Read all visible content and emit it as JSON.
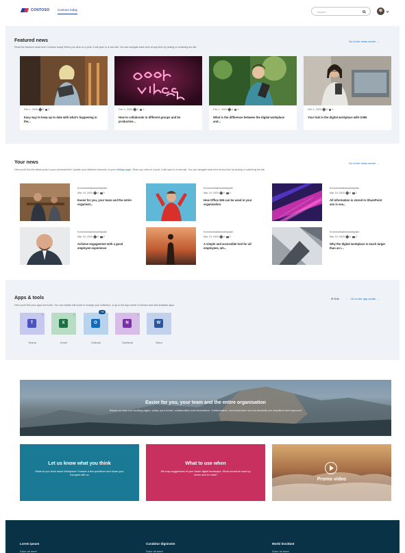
{
  "header": {
    "brand": "CONTOSO",
    "nav_tab": "Contoso today",
    "search_placeholder": "Search"
  },
  "featured": {
    "title": "Featured news",
    "description": "Read the featured news from Contoso today! When you click on a post, it will open in a new tab. You can navigate back here at any time by closing or switching the tab.",
    "link": "Go to the news center →",
    "cards": [
      {
        "date": "Feb 1, 2020",
        "likes": "0",
        "comments": "0",
        "title": "Easy way to keep up to date with what's happening in the..."
      },
      {
        "date": "Feb 1, 2020",
        "likes": "0",
        "comments": "0",
        "title": "How to collaborate in different groups and be productive..."
      },
      {
        "date": "Feb 1, 2020",
        "likes": "0",
        "comments": "0",
        "title": "What is the difference between the digital workplace and..."
      },
      {
        "date": "Feb 1, 2020",
        "likes": "0",
        "comments": "0",
        "title": "Your hub in the digital workplace with O365"
      }
    ]
  },
  "your_news": {
    "title": "Your news",
    "description_pre": "Here you'll find the latest posts in your personal feed. Update your selected channels on your ",
    "description_link": "settings page",
    "description_post": ". When you click on a post, it will open in a new tab. You can navigate back here at any time by closing or switching the tab.",
    "link": "Go to the news center →",
    "cards": [
      {
        "category": "Kommunikationswebplatz",
        "date": "Mar 19, 2020",
        "likes": "0",
        "comments": "0",
        "title": "Easier for you, your team and the entire organisat..."
      },
      {
        "category": "Kommunikationswebplatz",
        "date": "Mar 19, 2020",
        "likes": "0",
        "comments": "0",
        "title": "How Office 365 can be used in your organisation"
      },
      {
        "category": "Kommunikationswebplatz",
        "date": "Mar 19, 2020",
        "likes": "0",
        "comments": "0",
        "title": "All information is stored in SharePoint ans is sea..."
      },
      {
        "category": "Kommunikationswebplatz",
        "date": "Mar 19, 2020",
        "likes": "0",
        "comments": "0",
        "title": "Achieve engagement with a good employee experience"
      },
      {
        "category": "Kommunikationswebplatz",
        "date": "Mar 19, 2020",
        "likes": "0",
        "comments": "0",
        "title": "A simple and accessible tool for all employees, wh..."
      },
      {
        "category": "Kommunikationswebplatz",
        "date": "Mar 19, 2020",
        "likes": "0",
        "comments": "0",
        "title": "Why the digital workplace is much larger than an i..."
      }
    ]
  },
  "apps": {
    "title": "Apps & tools",
    "description": "Here you'll find your apps and tools. You can enable edit mode to change your collection, or go to the App center to browse and add available apps.",
    "edit_label": "Edit",
    "link": "Go to the app center →",
    "items": [
      {
        "name": "Teams",
        "letter": "T",
        "count": "1",
        "color": "#4b53bc",
        "bg": "#c5c8ef"
      },
      {
        "name": "Excel",
        "letter": "X",
        "count": "1",
        "color": "#1d7044",
        "bg": "#b9dcc4"
      },
      {
        "name": "Outlook",
        "letter": "O",
        "count": "+99",
        "color": "#0f6cbd",
        "bg": "#b7d3ee"
      },
      {
        "name": "OneNote",
        "letter": "N",
        "count": "1",
        "color": "#7b2fa8",
        "bg": "#d8bde8"
      },
      {
        "name": "Word",
        "letter": "W",
        "count": "",
        "color": "#2b579a",
        "bg": "#c3d2ec"
      }
    ]
  },
  "hero": {
    "title": "Easier for you, your team and the entire organisation",
    "description": "Based on only four landing pages, today, your board, collaboration and information. Collaboration, communication and productivity are simplified and improved"
  },
  "tiles": [
    {
      "title": "Let us know what you think",
      "description": "What do you think about Workplace? Answer a few questions and share your thoughts with us",
      "color": "#1a7a96"
    },
    {
      "title": "What to use when",
      "description": "We map suggestions of your future digital landscape. What should be used by whom and for what?",
      "color": "#c8305f"
    },
    {
      "title": "Promo video",
      "description": "",
      "color": "#b07850"
    }
  ],
  "footer": {
    "columns": [
      {
        "title": "Lorem ipsum",
        "link": "Dolor sit amet"
      },
      {
        "title": "Curabitur dignissim",
        "link": "Dolor sit amet"
      },
      {
        "title": "Morbi tincidunt",
        "link": "Dolor sit amet"
      }
    ]
  }
}
